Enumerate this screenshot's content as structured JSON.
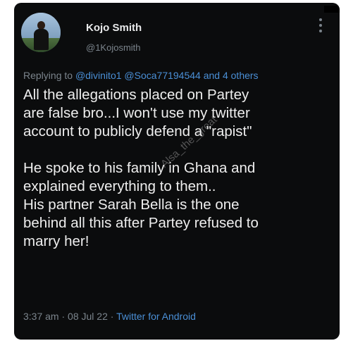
{
  "author": {
    "name": "Kojo Smith",
    "handle": "@1Kojosmith"
  },
  "reply": {
    "prefix": "Replying to ",
    "mention1": "@divinito1",
    "mention2": "@Soca77194544",
    "suffix": "and 4 others"
  },
  "tweet": {
    "lines": [
      "All the allegations placed on Partey",
      "are false bro...I won't use my twitter",
      "account to publicly defend a \"rapist\"",
      "He spoke to his family in Ghana and",
      "explained everything to them..",
      "His partner Sarah Bella is the one",
      "behind all this after Partey refused to",
      "marry her!"
    ]
  },
  "watermark": "Alsa_the_great",
  "meta": {
    "time": "3:37 am",
    "date": "08 Jul 22",
    "source": "Twitter for Android",
    "separator": "·"
  },
  "colors": {
    "background": "#0b0c0d",
    "text": "#eeeeee",
    "muted": "#7b848c",
    "accent": "#4a8fd6"
  },
  "icons": {
    "more": "more-vertical-icon"
  }
}
